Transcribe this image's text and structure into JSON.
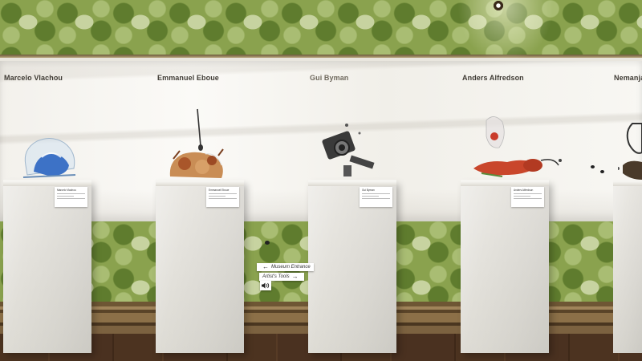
{
  "artists": [
    {
      "name": "Marcelo Vlachou",
      "card": "Marcelo Vlachou"
    },
    {
      "name": "Emmanuel Eboue",
      "card": "Emmanuel Eboue"
    },
    {
      "name": "Gui Byman",
      "card": "Gui Byman"
    },
    {
      "name": "Anders Alfredson",
      "card": "Anders Alfredson"
    },
    {
      "name": "Nemanja",
      "card": ""
    }
  ],
  "nav": {
    "museum_entrance": "Museum Entrance",
    "artists_tools": "Artist's Tools"
  },
  "icons": {
    "sound": "speaker-icon",
    "left_arrow": "arrow-left-icon",
    "right_arrow": "arrow-right-icon"
  },
  "colors": {
    "wallpaper": "#8aa24e",
    "frieze": "#f3f1ec",
    "pedestal": "#e4e2dc",
    "floor": "#4c3320"
  }
}
